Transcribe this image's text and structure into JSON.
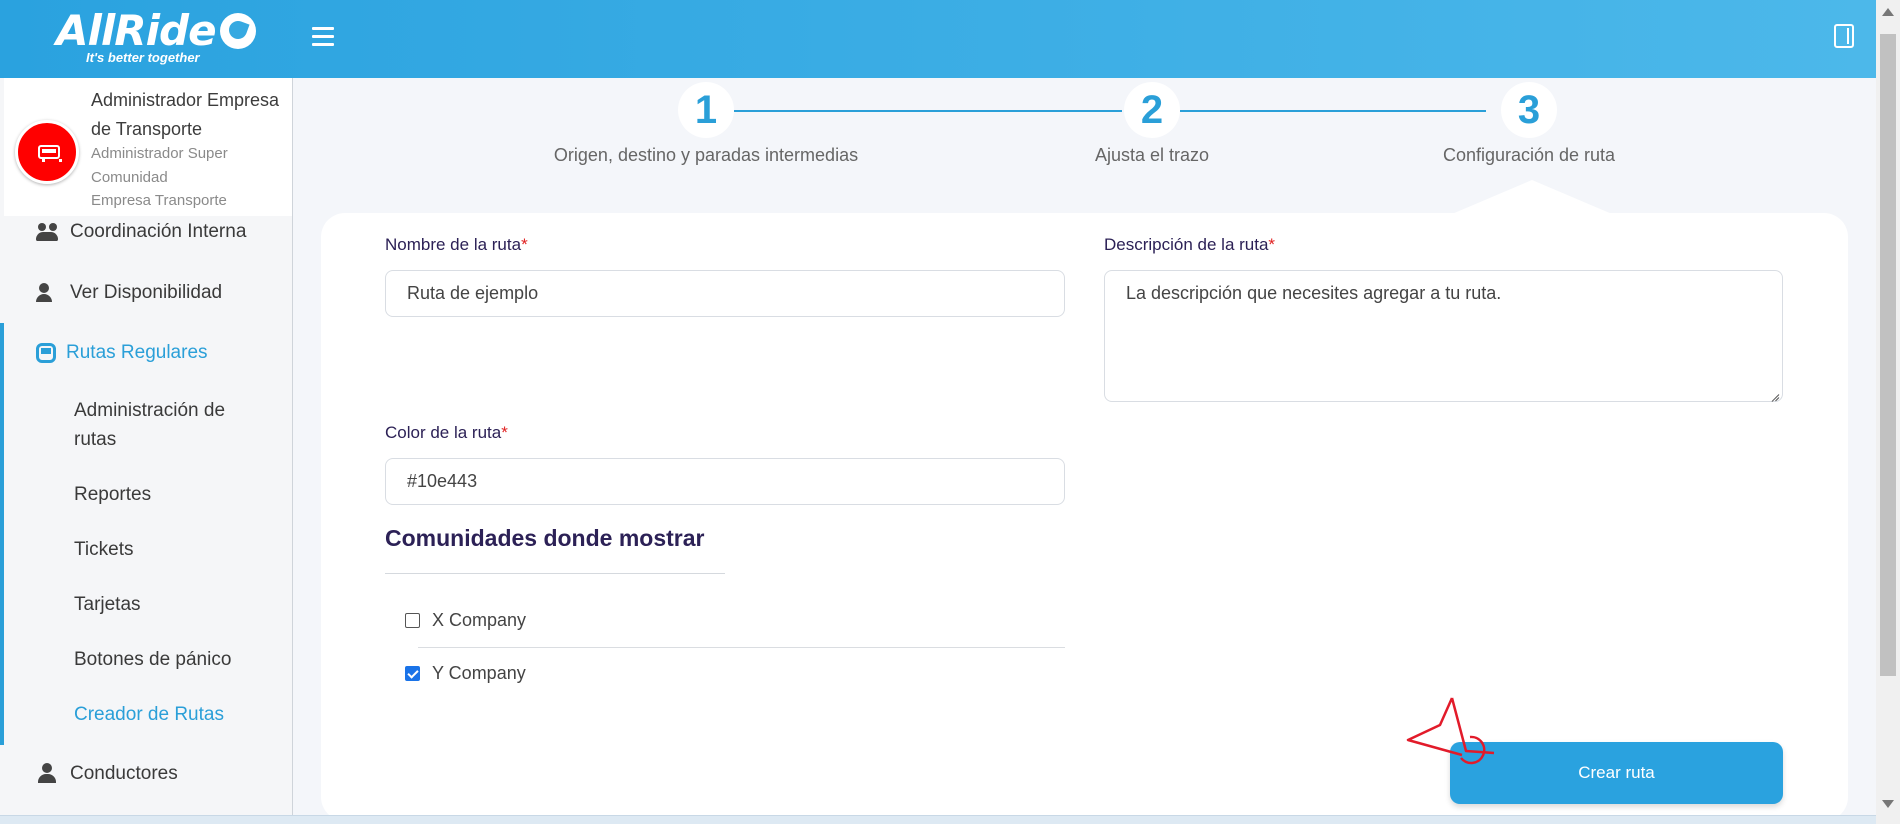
{
  "header": {
    "logo_text": "AllRide",
    "logo_tagline": "It's better together"
  },
  "profile": {
    "name": "Administrador Empresa de Transporte",
    "role": "Administrador Super",
    "community": "Comunidad",
    "company": "Empresa Transporte"
  },
  "sidebar": {
    "items": [
      {
        "label": "Coordinación Interna",
        "icon": "people-gear-icon"
      },
      {
        "label": "Ver Disponibilidad",
        "icon": "user-check-icon"
      },
      {
        "label": "Rutas Regulares",
        "icon": "bus-icon",
        "active": true
      },
      {
        "label": "Conductores",
        "icon": "driver-icon"
      }
    ],
    "subitems": [
      {
        "label": "Administración de rutas"
      },
      {
        "label": "Reportes"
      },
      {
        "label": "Tickets"
      },
      {
        "label": "Tarjetas"
      },
      {
        "label": "Botones de pánico"
      },
      {
        "label": "Creador de Rutas",
        "active": true
      }
    ]
  },
  "stepper": {
    "steps": [
      {
        "number": "1",
        "label": "Origen, destino y paradas intermedias"
      },
      {
        "number": "2",
        "label": "Ajusta el trazo"
      },
      {
        "number": "3",
        "label": "Configuración de ruta"
      }
    ],
    "current": 3
  },
  "form": {
    "name_label": "Nombre de la ruta",
    "name_value": "Ruta de ejemplo",
    "description_label": "Descripción de la ruta",
    "description_value": "La descripción que necesites agregar a tu ruta.",
    "color_label": "Color de la ruta",
    "color_value": "#10e443",
    "required_mark": "*",
    "communities_title": "Comunidades donde mostrar",
    "communities": [
      {
        "label": "X Company",
        "checked": false
      },
      {
        "label": "Y Company",
        "checked": true
      }
    ],
    "submit_label": "Crear ruta"
  },
  "colors": {
    "accent": "#2aa2df",
    "header_start": "#2aa2df",
    "header_end": "#4cb8ea",
    "avatar": "#ff0000",
    "label": "#2c2156",
    "required": "#e02020"
  }
}
